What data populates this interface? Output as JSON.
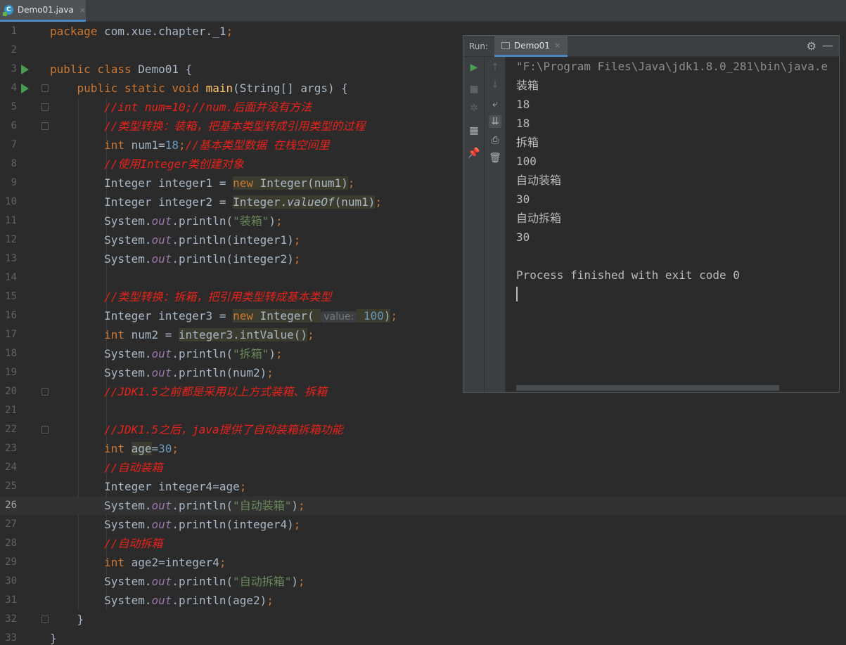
{
  "tab": {
    "icon_letter": "C",
    "label": "Demo01.java",
    "close": "×"
  },
  "lines": [
    {
      "n": "1",
      "tokens": [
        [
          "kw",
          "package "
        ],
        [
          "",
          "com.xue.chapter._1"
        ],
        [
          "kw",
          ";"
        ]
      ]
    },
    {
      "n": "2",
      "tokens": []
    },
    {
      "n": "3",
      "run": true,
      "tokens": [
        [
          "kw",
          "public class "
        ],
        [
          "",
          "Demo01 {"
        ]
      ]
    },
    {
      "n": "4",
      "run": true,
      "fold": true,
      "tokens": [
        [
          "",
          "    "
        ],
        [
          "kw",
          "public static void "
        ],
        [
          "fn",
          "main"
        ],
        [
          "",
          "(String[] args) {"
        ]
      ]
    },
    {
      "n": "5",
      "fold": true,
      "tokens": [
        [
          "",
          "        "
        ],
        [
          "cm",
          "//int num=10;//num.后面并没有方法"
        ]
      ]
    },
    {
      "n": "6",
      "fold": true,
      "tokens": [
        [
          "",
          "        "
        ],
        [
          "cm",
          "//类型转换：装箱，把基本类型转成引用类型的过程"
        ]
      ]
    },
    {
      "n": "7",
      "tokens": [
        [
          "",
          "        "
        ],
        [
          "kw",
          "int "
        ],
        [
          "",
          "num1="
        ],
        [
          "num",
          "18"
        ],
        [
          "kw",
          ";"
        ],
        [
          "cm",
          "//基本类型数据 在栈空间里"
        ]
      ]
    },
    {
      "n": "8",
      "tokens": [
        [
          "",
          "        "
        ],
        [
          "cm",
          "//使用Integer类创建对象"
        ]
      ]
    },
    {
      "n": "9",
      "tokens": [
        [
          "",
          "        Integer integer1 = "
        ],
        [
          "kw hl",
          "new "
        ],
        [
          "hl",
          "Integer(num1)"
        ],
        [
          "kw",
          ";"
        ]
      ]
    },
    {
      "n": "10",
      "tokens": [
        [
          "",
          "        Integer integer2 = "
        ],
        [
          "hl",
          "Integer."
        ],
        [
          "italic hl",
          "valueOf"
        ],
        [
          "hl",
          "(num1)"
        ],
        [
          "kw",
          ";"
        ]
      ]
    },
    {
      "n": "11",
      "tokens": [
        [
          "",
          "        System."
        ],
        [
          "static",
          "out"
        ],
        [
          "",
          ".println("
        ],
        [
          "str",
          "\"装箱\""
        ],
        [
          "",
          ")"
        ],
        [
          "kw",
          ";"
        ]
      ]
    },
    {
      "n": "12",
      "tokens": [
        [
          "",
          "        System."
        ],
        [
          "static",
          "out"
        ],
        [
          "",
          ".println(integer1)"
        ],
        [
          "kw",
          ";"
        ]
      ]
    },
    {
      "n": "13",
      "tokens": [
        [
          "",
          "        System."
        ],
        [
          "static",
          "out"
        ],
        [
          "",
          ".println(integer2)"
        ],
        [
          "kw",
          ";"
        ]
      ]
    },
    {
      "n": "14",
      "tokens": []
    },
    {
      "n": "15",
      "tokens": [
        [
          "",
          "        "
        ],
        [
          "cm",
          "//类型转换：拆箱，把引用类型转成基本类型"
        ]
      ]
    },
    {
      "n": "16",
      "tokens": [
        [
          "",
          "        Integer integer3 = "
        ],
        [
          "kw hl",
          "new "
        ],
        [
          "hl",
          "Integer( "
        ],
        [
          "hint",
          "value:"
        ],
        [
          "num hl",
          " 100"
        ],
        [
          "hl",
          ")"
        ],
        [
          "kw",
          ";"
        ]
      ]
    },
    {
      "n": "17",
      "tokens": [
        [
          "",
          "        "
        ],
        [
          "kw",
          "int "
        ],
        [
          "",
          "num2 = "
        ],
        [
          "hl",
          "integer3.intValue()"
        ],
        [
          "kw",
          ";"
        ]
      ]
    },
    {
      "n": "18",
      "tokens": [
        [
          "",
          "        System."
        ],
        [
          "static",
          "out"
        ],
        [
          "",
          ".println("
        ],
        [
          "str",
          "\"拆箱\""
        ],
        [
          "",
          ")"
        ],
        [
          "kw",
          ";"
        ]
      ]
    },
    {
      "n": "19",
      "tokens": [
        [
          "",
          "        System."
        ],
        [
          "static",
          "out"
        ],
        [
          "",
          ".println(num2)"
        ],
        [
          "kw",
          ";"
        ]
      ]
    },
    {
      "n": "20",
      "fold": true,
      "tokens": [
        [
          "",
          "        "
        ],
        [
          "cm",
          "//JDK1.5之前都是采用以上方式装箱、拆箱"
        ]
      ]
    },
    {
      "n": "21",
      "tokens": []
    },
    {
      "n": "22",
      "fold": true,
      "tokens": [
        [
          "",
          "        "
        ],
        [
          "cm",
          "//JDK1.5之后，java提供了自动装箱拆箱功能"
        ]
      ]
    },
    {
      "n": "23",
      "tokens": [
        [
          "",
          "        "
        ],
        [
          "kw",
          "int "
        ],
        [
          "hl",
          "age"
        ],
        [
          "",
          "="
        ],
        [
          "num",
          "30"
        ],
        [
          "kw",
          ";"
        ]
      ]
    },
    {
      "n": "24",
      "tokens": [
        [
          "",
          "        "
        ],
        [
          "cm",
          "//自动装箱"
        ]
      ]
    },
    {
      "n": "25",
      "tokens": [
        [
          "",
          "        Integer integer4=age"
        ],
        [
          "kw",
          ";"
        ]
      ]
    },
    {
      "n": "26",
      "current": true,
      "tokens": [
        [
          "",
          "        System."
        ],
        [
          "static",
          "out"
        ],
        [
          "",
          ".println("
        ],
        [
          "str",
          "\"自动装箱\""
        ],
        [
          "",
          ")"
        ],
        [
          "kw",
          ";"
        ]
      ]
    },
    {
      "n": "27",
      "tokens": [
        [
          "",
          "        System."
        ],
        [
          "static",
          "out"
        ],
        [
          "",
          ".println(integer4)"
        ],
        [
          "kw",
          ";"
        ]
      ]
    },
    {
      "n": "28",
      "tokens": [
        [
          "",
          "        "
        ],
        [
          "cm",
          "//自动拆箱"
        ]
      ]
    },
    {
      "n": "29",
      "tokens": [
        [
          "",
          "        "
        ],
        [
          "kw",
          "int "
        ],
        [
          "",
          "age2=integer4"
        ],
        [
          "kw",
          ";"
        ]
      ]
    },
    {
      "n": "30",
      "tokens": [
        [
          "",
          "        System."
        ],
        [
          "static",
          "out"
        ],
        [
          "",
          ".println("
        ],
        [
          "str",
          "\"自动拆箱\""
        ],
        [
          "",
          ")"
        ],
        [
          "kw",
          ";"
        ]
      ]
    },
    {
      "n": "31",
      "tokens": [
        [
          "",
          "        System."
        ],
        [
          "static",
          "out"
        ],
        [
          "",
          ".println(age2)"
        ],
        [
          "kw",
          ";"
        ]
      ]
    },
    {
      "n": "32",
      "fold": true,
      "tokens": [
        [
          "",
          "    }"
        ]
      ]
    },
    {
      "n": "33",
      "tokens": [
        [
          "",
          "}"
        ]
      ]
    }
  ],
  "run_panel": {
    "title": "Run:",
    "tab_label": "Demo01",
    "tab_close": "×",
    "settings_icon": "⚙",
    "minimize_icon": "—",
    "toolbar_left": [
      {
        "name": "rerun-icon",
        "glyph": "▶",
        "cls": "play"
      },
      {
        "name": "stop-icon",
        "glyph": "■",
        "cls": "dim"
      },
      {
        "name": "debug-settings-icon",
        "glyph": "✲",
        "cls": "dim"
      },
      {
        "name": "layout-icon",
        "glyph": "▦",
        "cls": ""
      },
      {
        "name": "pin-icon",
        "glyph": "📌",
        "cls": ""
      }
    ],
    "toolbar_right": [
      {
        "name": "scroll-up-icon",
        "glyph": "↑",
        "cls": "dim"
      },
      {
        "name": "scroll-down-icon",
        "glyph": "↓",
        "cls": "dim"
      },
      {
        "name": "soft-wrap-icon",
        "glyph": "⤶",
        "cls": ""
      },
      {
        "name": "scroll-to-end-icon",
        "glyph": "⇊",
        "cls": "active"
      },
      {
        "name": "print-icon",
        "glyph": "⎙",
        "cls": ""
      },
      {
        "name": "clear-icon",
        "glyph": "🗑",
        "cls": ""
      }
    ],
    "output": [
      "\"F:\\Program Files\\Java\\jdk1.8.0_281\\bin\\java.e",
      "装箱",
      "18",
      "18",
      "拆箱",
      "100",
      "自动装箱",
      "30",
      "自动拆箱",
      "30",
      "",
      "Process finished with exit code 0"
    ]
  }
}
